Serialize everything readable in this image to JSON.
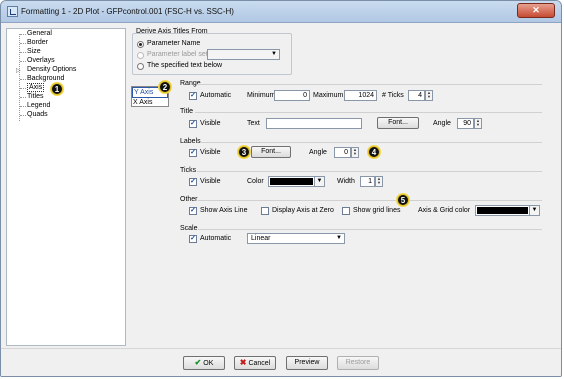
{
  "window": {
    "title": "Formatting 1 - 2D Plot - GFPcontrol.001 (FSC-H vs. SSC-H)",
    "close_glyph": "✕"
  },
  "tree": {
    "items": [
      "General",
      "Border",
      "Size",
      "Overlays",
      "Density Options",
      "Background",
      "Axis",
      "Titles",
      "Legend",
      "Quads"
    ],
    "selected": "Axis"
  },
  "axis_list": {
    "items": [
      "Y Axis",
      "X Axis"
    ],
    "selected": "Y Axis"
  },
  "derive": {
    "title": "Derive Axis Titles From",
    "options": [
      "Parameter Name",
      "Parameter label set",
      "The specified text below"
    ],
    "selected": "Parameter Name"
  },
  "range": {
    "title": "Range",
    "automatic_label": "Automatic",
    "automatic": true,
    "min_label": "Minimum",
    "min": "0",
    "max_label": "Maximum",
    "max": "1024",
    "ticks_label": "# Ticks",
    "ticks": "4"
  },
  "title_group": {
    "title": "Title",
    "visible_label": "Visible",
    "visible": true,
    "text_label": "Text",
    "text": "",
    "font_button": "Font...",
    "angle_label": "Angle",
    "angle": "90"
  },
  "labels": {
    "title": "Labels",
    "visible_label": "Visible",
    "visible": true,
    "font_button": "Font...",
    "angle_label": "Angle",
    "angle": "0"
  },
  "ticks_group": {
    "title": "Ticks",
    "visible_label": "Visible",
    "visible": true,
    "color_label": "Color",
    "color": "#000000",
    "width_label": "Width",
    "width": "1"
  },
  "other": {
    "title": "Other",
    "show_axis_line": "Show Axis Line",
    "display_axis_zero": "Display Axis at Zero",
    "show_grid": "Show grid lines",
    "grid_color_label": "Axis & Grid color",
    "grid_color": "#000000"
  },
  "scale": {
    "title": "Scale",
    "automatic_label": "Automatic",
    "automatic": true,
    "type": "Linear"
  },
  "buttons": {
    "ok": "OK",
    "cancel": "Cancel",
    "preview": "Preview",
    "restore": "Restore"
  },
  "callouts": [
    "1",
    "2",
    "3",
    "4",
    "5"
  ],
  "icons": {
    "check": "✓",
    "dropdown": "▼",
    "spin_up": "▲",
    "spin_down": "▼",
    "expand": "▷",
    "ok": "✔",
    "cancel": "✖"
  }
}
